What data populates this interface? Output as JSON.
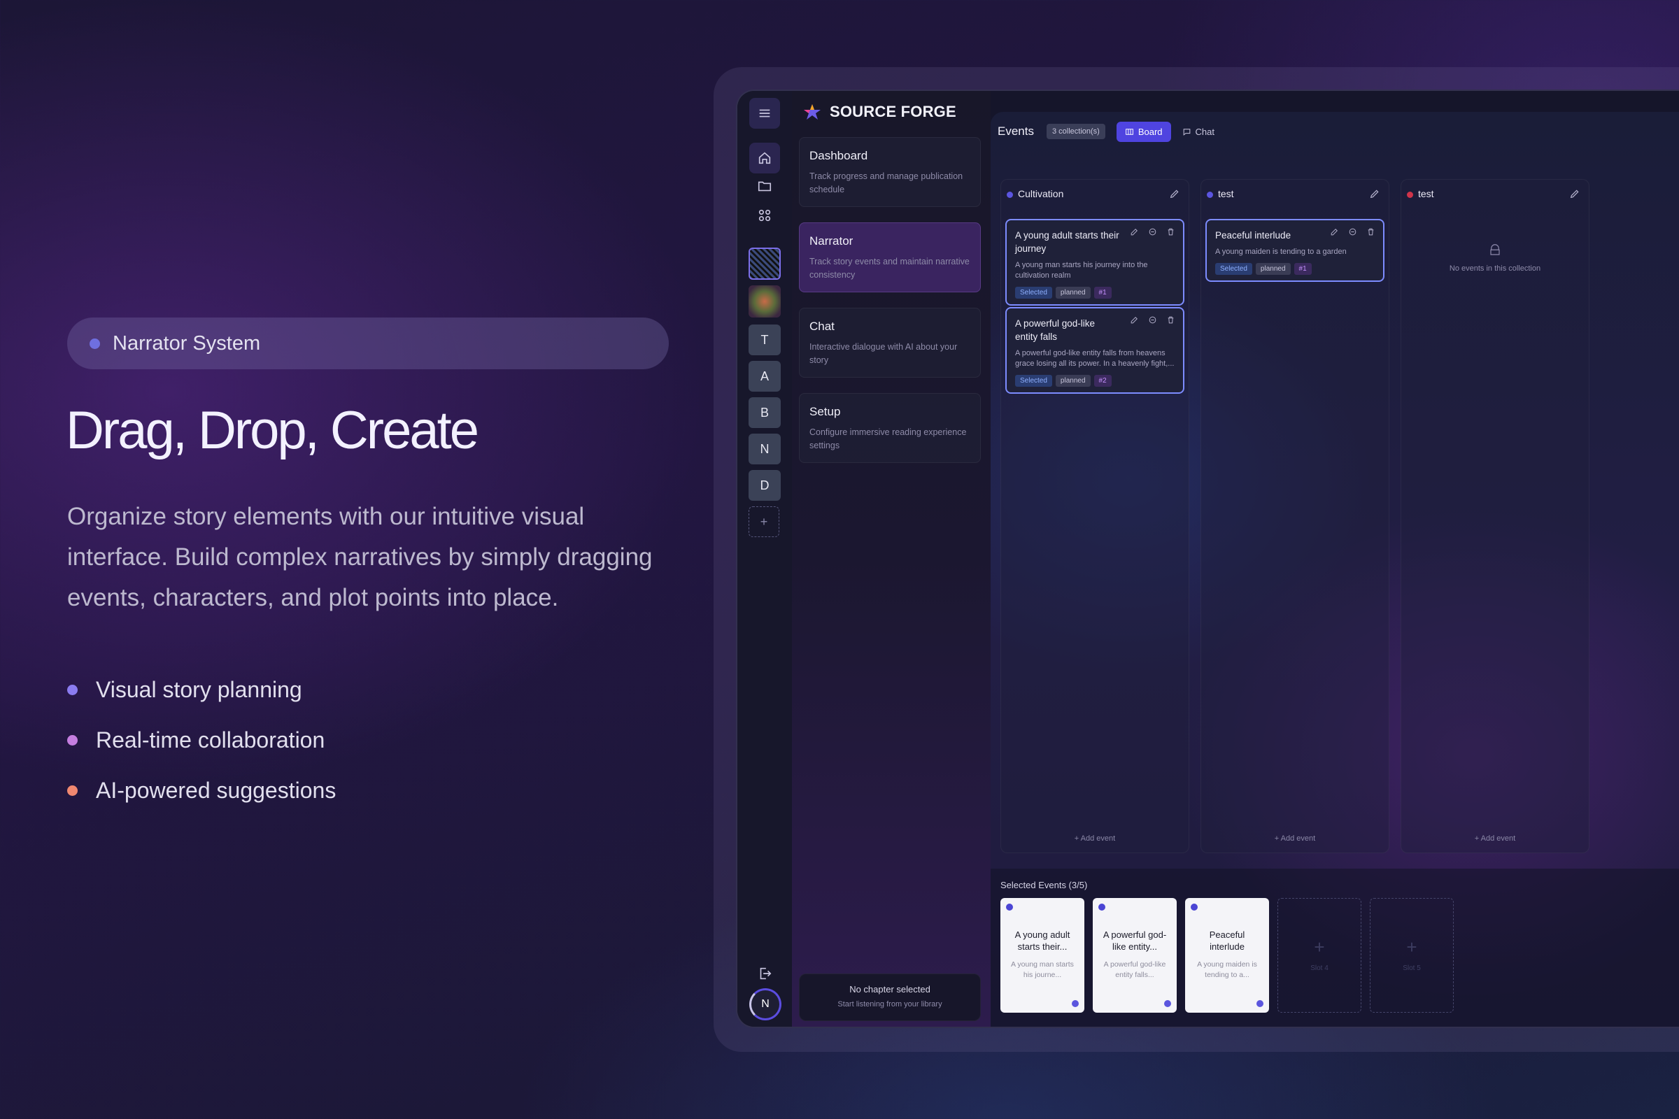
{
  "hero": {
    "pill_label": "Narrator System",
    "headline": "Drag, Drop, Create",
    "description": "Organize story elements with our intuitive visual interface. Build complex narratives by simply dragging events, characters, and plot points into place.",
    "features": [
      {
        "label": "Visual story planning",
        "color": "#8b7cf0"
      },
      {
        "label": "Real-time collaboration",
        "color": "#c57ee0"
      },
      {
        "label": "AI-powered suggestions",
        "color": "#f08870"
      }
    ]
  },
  "rail": {
    "letters": [
      "T",
      "A",
      "B",
      "N",
      "D"
    ],
    "add_label": "+",
    "avatar_initial": "N",
    "icons": [
      "menu-icon",
      "home-icon",
      "folder-icon",
      "grid-icon",
      "logout-icon"
    ]
  },
  "nav": {
    "brand": "SOURCE FORGE",
    "items": [
      {
        "title": "Dashboard",
        "subtitle": "Track progress and manage publication schedule"
      },
      {
        "title": "Narrator",
        "subtitle": "Track story events and maintain narrative consistency"
      },
      {
        "title": "Chat",
        "subtitle": "Interactive dialogue with AI about your story"
      },
      {
        "title": "Setup",
        "subtitle": "Configure immersive reading experience settings"
      }
    ],
    "now_playing": {
      "title": "No chapter selected",
      "subtitle": "Start listening from your library"
    }
  },
  "toolbar": {
    "title": "Events",
    "badge": "3 collection(s)",
    "tab_board": "Board",
    "tab_chat": "Chat"
  },
  "columns": [
    {
      "name": "Cultivation",
      "dot_color": "#5b55e0",
      "cards": [
        {
          "title": "A young adult starts their journey",
          "desc": "A young man starts his journey into the cultivation realm",
          "tag_selected": "Selected",
          "tag_status": "planned",
          "tag_num": "#1"
        },
        {
          "title": "A powerful god-like entity falls",
          "desc": "A powerful god-like entity falls from heavens grace losing all its power. In a heavenly fight,...",
          "tag_selected": "Selected",
          "tag_status": "planned",
          "tag_num": "#2"
        }
      ],
      "add_label": "+ Add event"
    },
    {
      "name": "test",
      "dot_color": "#5b55e0",
      "cards": [
        {
          "title": "Peaceful interlude",
          "desc": "A young maiden is tending to a garden",
          "tag_selected": "Selected",
          "tag_status": "planned",
          "tag_num": "#1"
        }
      ],
      "add_label": "+ Add event"
    },
    {
      "name": "test",
      "dot_color": "#d0344a",
      "empty_text": "No events in this collection",
      "add_label": "+ Add event"
    }
  ],
  "tray": {
    "title": "Selected Events (3/5)",
    "slots": [
      {
        "title": "A young adult starts their...",
        "desc": "A young man starts his journe..."
      },
      {
        "title": "A powerful god-like entity...",
        "desc": "A powerful god-like entity falls..."
      },
      {
        "title": "Peaceful interlude",
        "desc": "A young maiden is tending to a..."
      }
    ],
    "empty_slots": [
      {
        "plus": "+",
        "label": "Slot 4"
      },
      {
        "plus": "+",
        "label": "Slot 5"
      }
    ]
  }
}
